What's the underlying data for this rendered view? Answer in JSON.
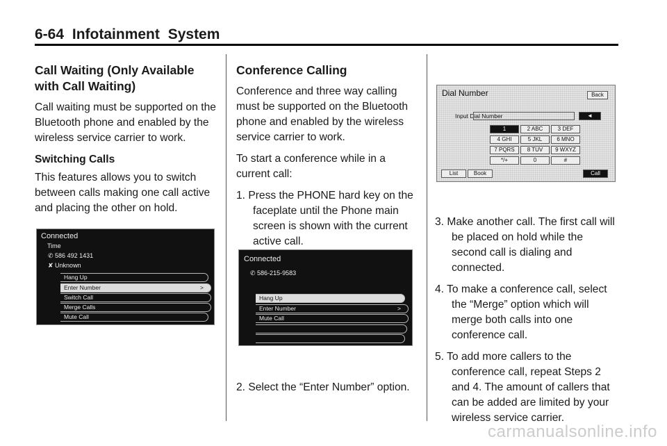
{
  "header": {
    "page": "6-64",
    "title": "Infotainment System"
  },
  "col1": {
    "heading": "Call Waiting (Only Available with Call Waiting)",
    "p1": "Call waiting must be supported on the Bluetooth phone and enabled by the wireless service carrier to work.",
    "subheading": "Switching Calls",
    "p2": "This features allows you to switch between calls making one call active and placing the other on hold.",
    "screen": {
      "title": "Connected",
      "line1": "Time",
      "line2": "586 492 1431",
      "line3": "Unknown",
      "items": [
        "Hang Up",
        "Enter Number",
        "Switch Call",
        "Merge Calls",
        "Mute Call"
      ],
      "arrow": ">"
    }
  },
  "col2": {
    "heading": "Conference Calling",
    "p1": "Conference and three way calling must be supported on the Bluetooth phone and enabled by the wireless service carrier to work.",
    "p2": "To start a conference while in a current call:",
    "step1": "1.  Press the PHONE hard key on the faceplate until the Phone main screen is shown with the current active call.",
    "step2": "2.  Select the “Enter Number” option.",
    "screen": {
      "title": "Connected",
      "number": "586-215-9583",
      "items": [
        "Hang Up",
        "Enter Number",
        "Mute Call",
        "",
        ""
      ],
      "arrow": ">"
    }
  },
  "col3": {
    "screen": {
      "title": "Dial Number",
      "back": "Back",
      "input_label": "Input Dial Number",
      "keys": [
        "1",
        "2 ABC",
        "3 DEF",
        "4 GHI",
        "5 JKL",
        "6 MNO",
        "7 PQRS",
        "8 TUV",
        "9 WXYZ",
        "*/+",
        "0",
        "#"
      ],
      "list": "List",
      "book": "Book",
      "call": "Call",
      "backspace": "◄"
    },
    "step3": "3.  Make another call. The first call will be placed on hold while the second call is dialing and connected.",
    "step4": "4.  To make a conference call, select the “Merge” option which will merge both calls into one conference call.",
    "step5": "5.  To add more callers to the conference call, repeat Steps 2 and 4. The amount of callers that can be added are limited by your wireless service carrier."
  },
  "watermark": "carmanualsonline.info"
}
